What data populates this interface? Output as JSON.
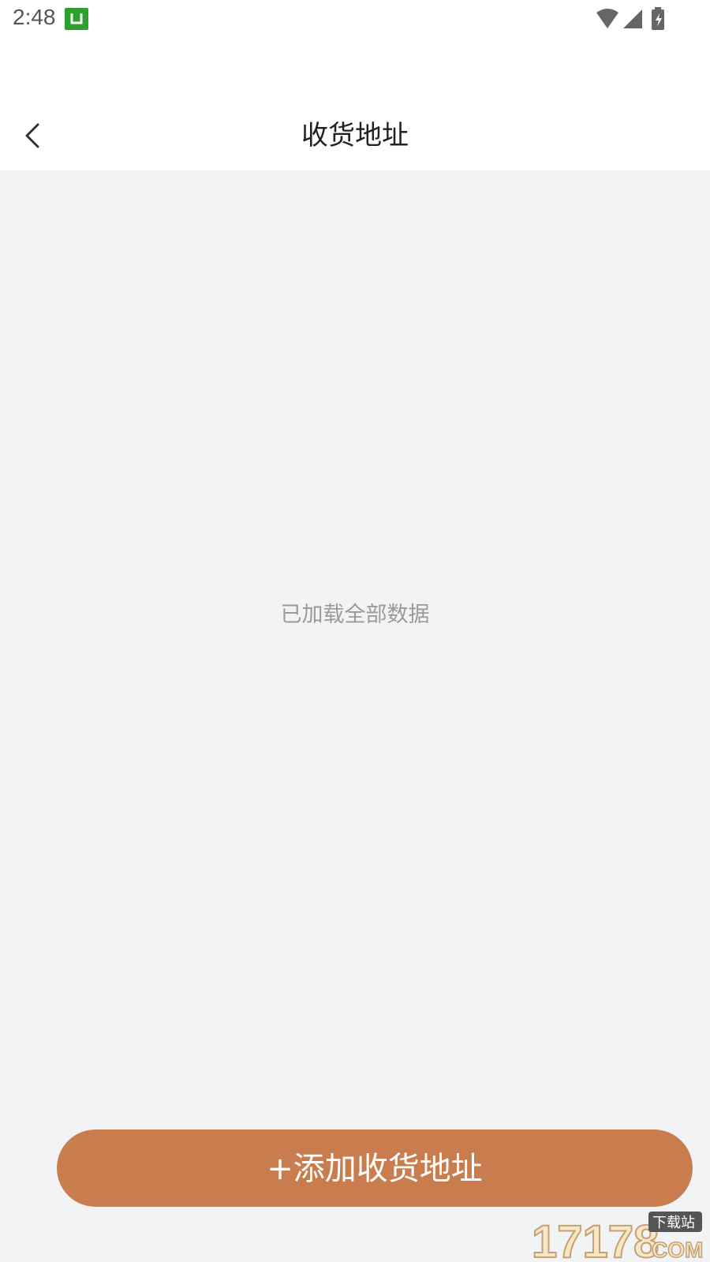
{
  "status_bar": {
    "time": "2:48",
    "app_badge_icon": "app-notification-icon",
    "wifi_icon": "wifi-icon",
    "signal_icon": "cell-signal-icon",
    "battery_icon": "battery-charging-icon"
  },
  "header": {
    "back_icon": "chevron-left-icon",
    "title": "收货地址"
  },
  "content": {
    "empty_message": "已加载全部数据"
  },
  "footer": {
    "add_button_label": "+添加收货地址"
  },
  "colors": {
    "accent": "#c97d4f",
    "background": "#f2f3f5",
    "header_bg": "#ffffff",
    "title_text": "#222222",
    "muted_text": "#9a9a9a",
    "badge_green": "#2ca02c"
  },
  "watermark": {
    "number": "17178",
    "domain": "COM",
    "tagline": "下载站"
  }
}
